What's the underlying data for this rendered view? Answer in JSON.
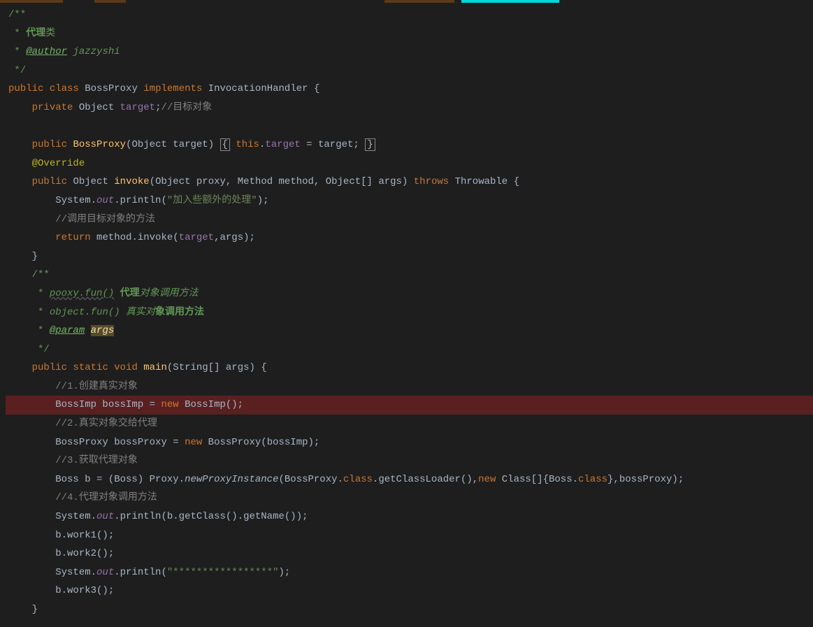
{
  "code": {
    "l1": "/**",
    "l2_star": " * ",
    "l2_text": "代理",
    "l2_text2": "类",
    "l3_star": " * ",
    "l3_tag": "@author",
    "l3_author": " jazzyshi",
    "l4": " */",
    "l5_kw1": "public",
    "l5_kw2": "class",
    "l5_name": "BossProxy",
    "l5_kw3": "implements",
    "l5_impl": "InvocationHandler",
    "l5_brace": "{",
    "l6_kw": "private",
    "l6_type": "Object",
    "l6_field": "target",
    "l6_semi": ";",
    "l6_comment": "//目标对象",
    "l7_kw": "public",
    "l7_name": "BossProxy",
    "l7_ptype": "Object",
    "l7_pname": "target",
    "l7_b1": "{",
    "l7_this": "this",
    "l7_field": "target",
    "l7_assign": " = target;",
    "l7_b2": "}",
    "l8_anno": "@Override",
    "l9_kw": "public",
    "l9_type": "Object",
    "l9_name": "invoke",
    "l9_params": "(Object proxy, Method method, Object[] args)",
    "l9_throws": "throws",
    "l9_ex": "Throwable {",
    "l10_sys": "System.",
    "l10_out": "out",
    "l10_print": ".println(",
    "l10_str": "\"加入些额外的处理\"",
    "l10_end": ");",
    "l11": "//调用目标对象的方法",
    "l12_kw": "return",
    "l12_call": " method.invoke(",
    "l12_f": "target",
    "l12_rest": ",args);",
    "l13": "}",
    "l14": "/**",
    "l15_star": " * ",
    "l15_code": "pooxy.fun()",
    "l15_text": " 代理",
    "l15_text2": "对象调用方法",
    "l16_star": " * ",
    "l16_code": "object.fun()",
    "l16_text": " 真实对",
    "l16_text2": "象调用方法",
    "l17_star": " * ",
    "l17_tag": "@param",
    "l17_param": "args",
    "l18": " */",
    "l19_kw1": "public",
    "l19_kw2": "static",
    "l19_kw3": "void",
    "l19_name": "main",
    "l19_params": "(String[] args) {",
    "l20": "//1.创建真实对象",
    "l21_decl": "BossImp bossImp = ",
    "l21_new": "new",
    "l21_call": " BossImp();",
    "l22": "//2.真实对象交给代理",
    "l23_decl": "BossProxy bossProxy = ",
    "l23_new": "new",
    "l23_call": " BossProxy(bossImp);",
    "l24": "//3.获取代理对象",
    "l25_decl": "Boss b = (Boss) Proxy.",
    "l25_method": "newProxyInstance",
    "l25_p1": "(BossProxy.",
    "l25_kw1": "class",
    "l25_p2": ".getClassLoader(),",
    "l25_new": "new",
    "l25_p3": " Class[]{Boss.",
    "l25_kw2": "class",
    "l25_p4": "},bossProxy);",
    "l26": "//4.代理对象调用方法",
    "l27_sys": "System.",
    "l27_out": "out",
    "l27_rest": ".println(b.getClass().getName());",
    "l28": "b.work1();",
    "l29": "b.work2();",
    "l30_sys": "System.",
    "l30_out": "out",
    "l30_print": ".println(",
    "l30_str": "\"*****************\"",
    "l30_end": ");",
    "l31": "b.work3();",
    "l32": "}"
  }
}
